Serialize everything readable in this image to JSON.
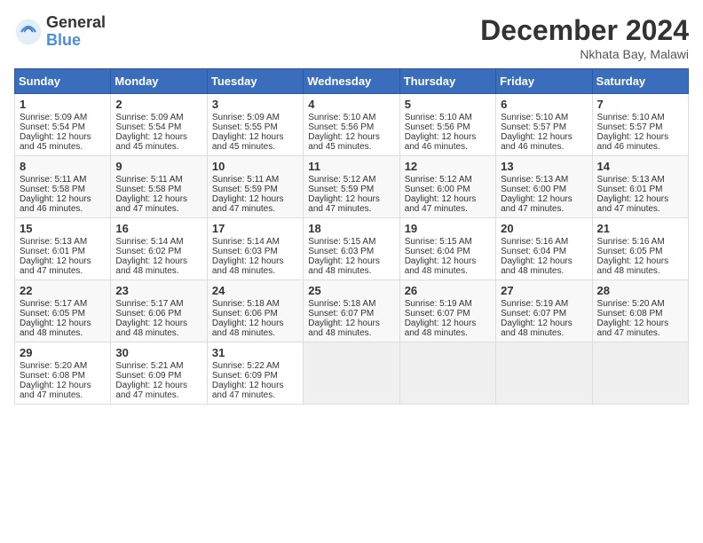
{
  "logo": {
    "general": "General",
    "blue": "Blue"
  },
  "title": "December 2024",
  "location": "Nkhata Bay, Malawi",
  "days_of_week": [
    "Sunday",
    "Monday",
    "Tuesday",
    "Wednesday",
    "Thursday",
    "Friday",
    "Saturday"
  ],
  "weeks": [
    [
      {
        "day": "1",
        "lines": [
          "Sunrise: 5:09 AM",
          "Sunset: 5:54 PM",
          "Daylight: 12 hours",
          "and 45 minutes."
        ]
      },
      {
        "day": "2",
        "lines": [
          "Sunrise: 5:09 AM",
          "Sunset: 5:54 PM",
          "Daylight: 12 hours",
          "and 45 minutes."
        ]
      },
      {
        "day": "3",
        "lines": [
          "Sunrise: 5:09 AM",
          "Sunset: 5:55 PM",
          "Daylight: 12 hours",
          "and 45 minutes."
        ]
      },
      {
        "day": "4",
        "lines": [
          "Sunrise: 5:10 AM",
          "Sunset: 5:56 PM",
          "Daylight: 12 hours",
          "and 45 minutes."
        ]
      },
      {
        "day": "5",
        "lines": [
          "Sunrise: 5:10 AM",
          "Sunset: 5:56 PM",
          "Daylight: 12 hours",
          "and 46 minutes."
        ]
      },
      {
        "day": "6",
        "lines": [
          "Sunrise: 5:10 AM",
          "Sunset: 5:57 PM",
          "Daylight: 12 hours",
          "and 46 minutes."
        ]
      },
      {
        "day": "7",
        "lines": [
          "Sunrise: 5:10 AM",
          "Sunset: 5:57 PM",
          "Daylight: 12 hours",
          "and 46 minutes."
        ]
      }
    ],
    [
      {
        "day": "8",
        "lines": [
          "Sunrise: 5:11 AM",
          "Sunset: 5:58 PM",
          "Daylight: 12 hours",
          "and 46 minutes."
        ]
      },
      {
        "day": "9",
        "lines": [
          "Sunrise: 5:11 AM",
          "Sunset: 5:58 PM",
          "Daylight: 12 hours",
          "and 47 minutes."
        ]
      },
      {
        "day": "10",
        "lines": [
          "Sunrise: 5:11 AM",
          "Sunset: 5:59 PM",
          "Daylight: 12 hours",
          "and 47 minutes."
        ]
      },
      {
        "day": "11",
        "lines": [
          "Sunrise: 5:12 AM",
          "Sunset: 5:59 PM",
          "Daylight: 12 hours",
          "and 47 minutes."
        ]
      },
      {
        "day": "12",
        "lines": [
          "Sunrise: 5:12 AM",
          "Sunset: 6:00 PM",
          "Daylight: 12 hours",
          "and 47 minutes."
        ]
      },
      {
        "day": "13",
        "lines": [
          "Sunrise: 5:13 AM",
          "Sunset: 6:00 PM",
          "Daylight: 12 hours",
          "and 47 minutes."
        ]
      },
      {
        "day": "14",
        "lines": [
          "Sunrise: 5:13 AM",
          "Sunset: 6:01 PM",
          "Daylight: 12 hours",
          "and 47 minutes."
        ]
      }
    ],
    [
      {
        "day": "15",
        "lines": [
          "Sunrise: 5:13 AM",
          "Sunset: 6:01 PM",
          "Daylight: 12 hours",
          "and 47 minutes."
        ]
      },
      {
        "day": "16",
        "lines": [
          "Sunrise: 5:14 AM",
          "Sunset: 6:02 PM",
          "Daylight: 12 hours",
          "and 48 minutes."
        ]
      },
      {
        "day": "17",
        "lines": [
          "Sunrise: 5:14 AM",
          "Sunset: 6:03 PM",
          "Daylight: 12 hours",
          "and 48 minutes."
        ]
      },
      {
        "day": "18",
        "lines": [
          "Sunrise: 5:15 AM",
          "Sunset: 6:03 PM",
          "Daylight: 12 hours",
          "and 48 minutes."
        ]
      },
      {
        "day": "19",
        "lines": [
          "Sunrise: 5:15 AM",
          "Sunset: 6:04 PM",
          "Daylight: 12 hours",
          "and 48 minutes."
        ]
      },
      {
        "day": "20",
        "lines": [
          "Sunrise: 5:16 AM",
          "Sunset: 6:04 PM",
          "Daylight: 12 hours",
          "and 48 minutes."
        ]
      },
      {
        "day": "21",
        "lines": [
          "Sunrise: 5:16 AM",
          "Sunset: 6:05 PM",
          "Daylight: 12 hours",
          "and 48 minutes."
        ]
      }
    ],
    [
      {
        "day": "22",
        "lines": [
          "Sunrise: 5:17 AM",
          "Sunset: 6:05 PM",
          "Daylight: 12 hours",
          "and 48 minutes."
        ]
      },
      {
        "day": "23",
        "lines": [
          "Sunrise: 5:17 AM",
          "Sunset: 6:06 PM",
          "Daylight: 12 hours",
          "and 48 minutes."
        ]
      },
      {
        "day": "24",
        "lines": [
          "Sunrise: 5:18 AM",
          "Sunset: 6:06 PM",
          "Daylight: 12 hours",
          "and 48 minutes."
        ]
      },
      {
        "day": "25",
        "lines": [
          "Sunrise: 5:18 AM",
          "Sunset: 6:07 PM",
          "Daylight: 12 hours",
          "and 48 minutes."
        ]
      },
      {
        "day": "26",
        "lines": [
          "Sunrise: 5:19 AM",
          "Sunset: 6:07 PM",
          "Daylight: 12 hours",
          "and 48 minutes."
        ]
      },
      {
        "day": "27",
        "lines": [
          "Sunrise: 5:19 AM",
          "Sunset: 6:07 PM",
          "Daylight: 12 hours",
          "and 48 minutes."
        ]
      },
      {
        "day": "28",
        "lines": [
          "Sunrise: 5:20 AM",
          "Sunset: 6:08 PM",
          "Daylight: 12 hours",
          "and 47 minutes."
        ]
      }
    ],
    [
      {
        "day": "29",
        "lines": [
          "Sunrise: 5:20 AM",
          "Sunset: 6:08 PM",
          "Daylight: 12 hours",
          "and 47 minutes."
        ]
      },
      {
        "day": "30",
        "lines": [
          "Sunrise: 5:21 AM",
          "Sunset: 6:09 PM",
          "Daylight: 12 hours",
          "and 47 minutes."
        ]
      },
      {
        "day": "31",
        "lines": [
          "Sunrise: 5:22 AM",
          "Sunset: 6:09 PM",
          "Daylight: 12 hours",
          "and 47 minutes."
        ]
      },
      null,
      null,
      null,
      null
    ]
  ]
}
